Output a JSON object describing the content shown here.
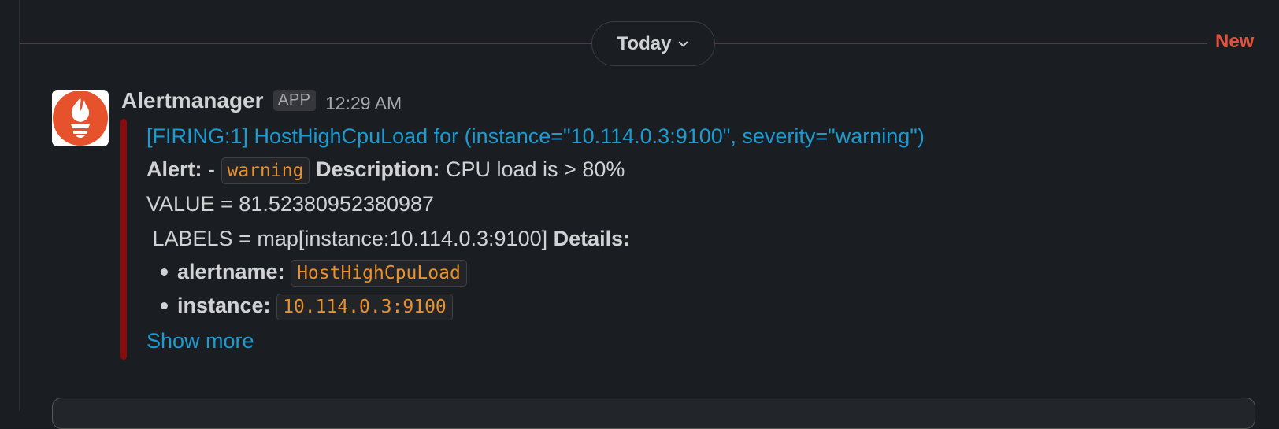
{
  "divider": {
    "date_label": "Today",
    "new_label": "New"
  },
  "message": {
    "sender": "Alertmanager",
    "badge": "APP",
    "time": "12:29 AM",
    "title": "[FIRING:1] HostHighCpuLoad for  (instance=\"10.114.0.3:9100\", severity=\"warning\")",
    "alert_label": "Alert:",
    "alert_dash": " - ",
    "severity_code": "warning",
    "description_label": "Description:",
    "description_text": " CPU load is > 80%",
    "value_line": " VALUE = 81.52380952380987",
    "labels_line": " LABELS = map[instance:10.114.0.3:9100]",
    "details_label": "Details:",
    "details": [
      {
        "key": "alertname:",
        "value": "HostHighCpuLoad"
      },
      {
        "key": "instance:",
        "value": "10.114.0.3:9100"
      }
    ],
    "show_more": "Show more"
  },
  "colors": {
    "background": "#1a1d21",
    "link": "#1d9bd1",
    "code_text": "#e8912d",
    "new_divider": "#e2513b",
    "attachment_bar": "#8b0a0a",
    "avatar_accent": "#e6522c"
  },
  "icons": {
    "avatar": "prometheus-flame-logo",
    "date_chevron": "chevron-down-icon"
  }
}
